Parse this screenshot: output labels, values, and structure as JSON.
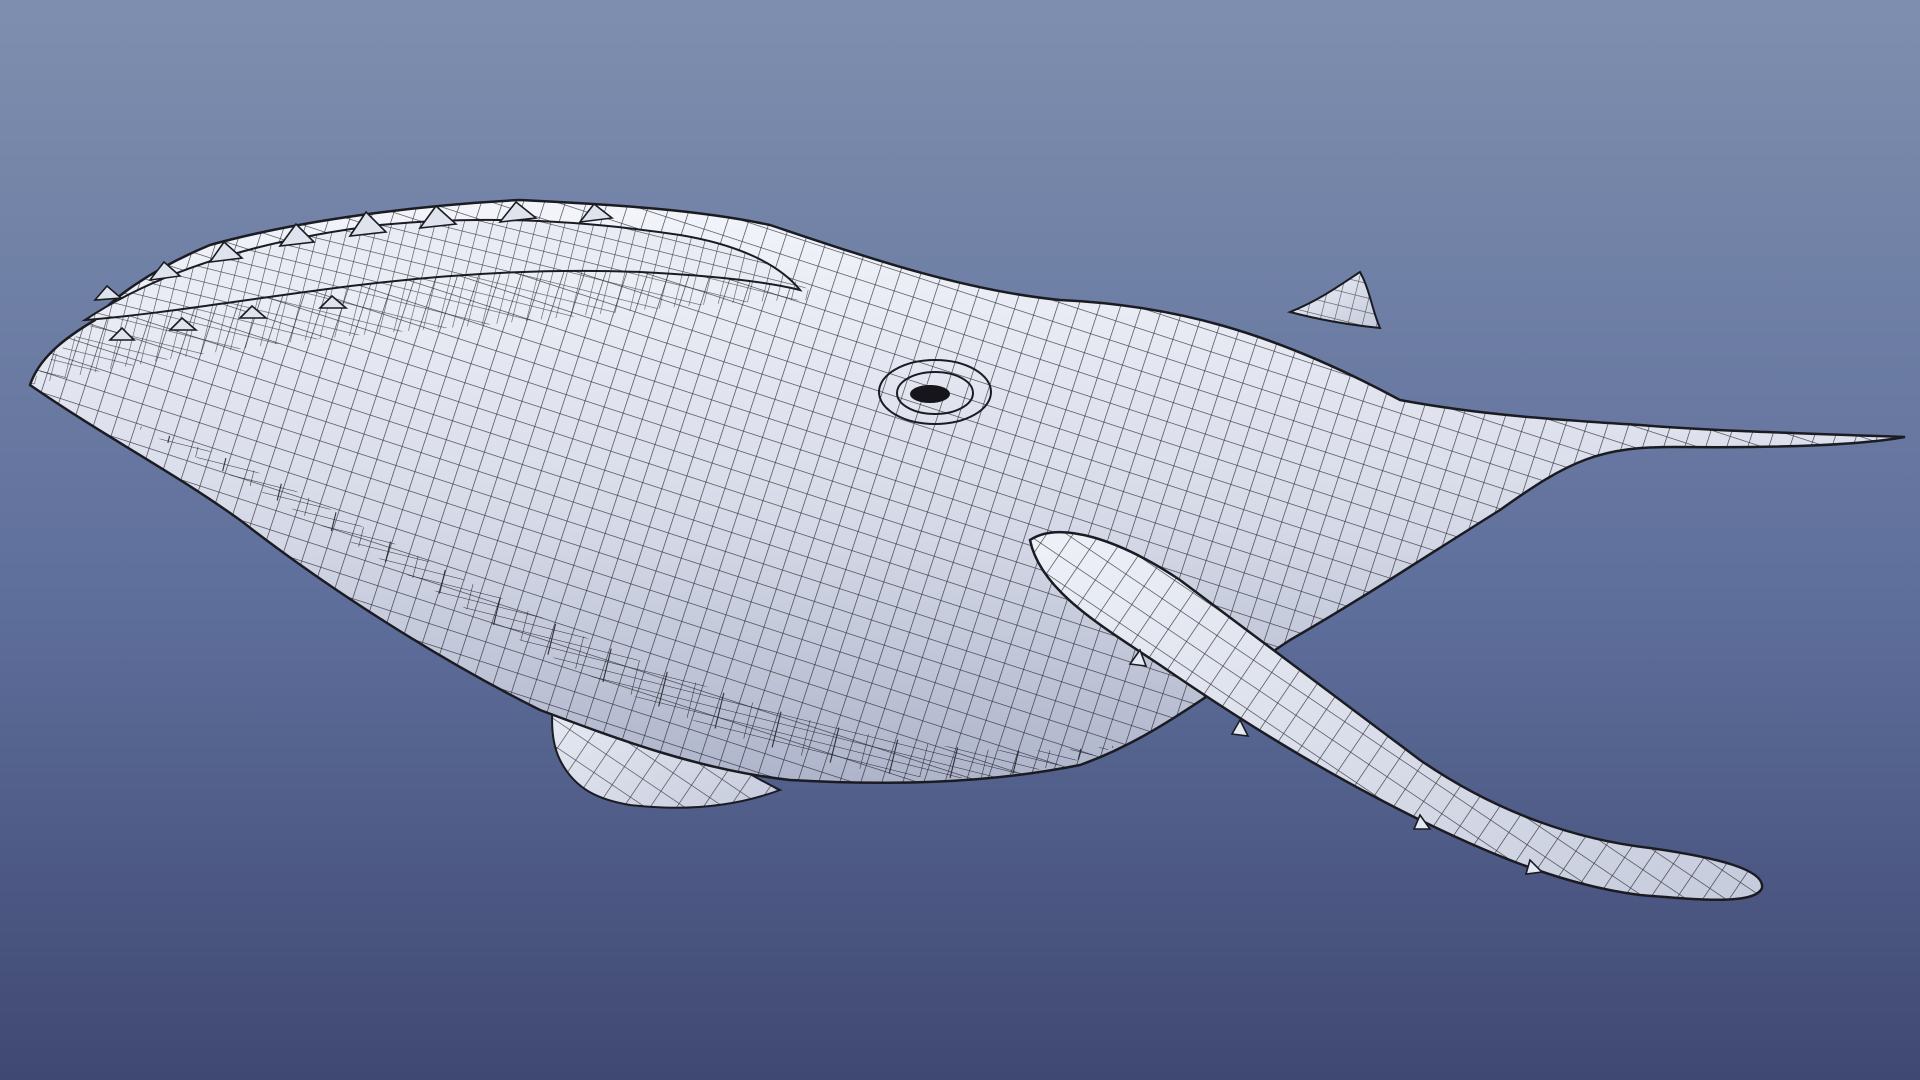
{
  "scene": {
    "subject_icon": "humpback-whale-wireframe-model",
    "render_style": "shaded-wireframe",
    "background_gradient": [
      "#7e8fae",
      "#5f6f9c",
      "#3f4872"
    ],
    "mesh_fill_light": "#f3f5fb",
    "mesh_fill_shade": "#aeb4ca",
    "wire_color": "#1b1b22"
  }
}
